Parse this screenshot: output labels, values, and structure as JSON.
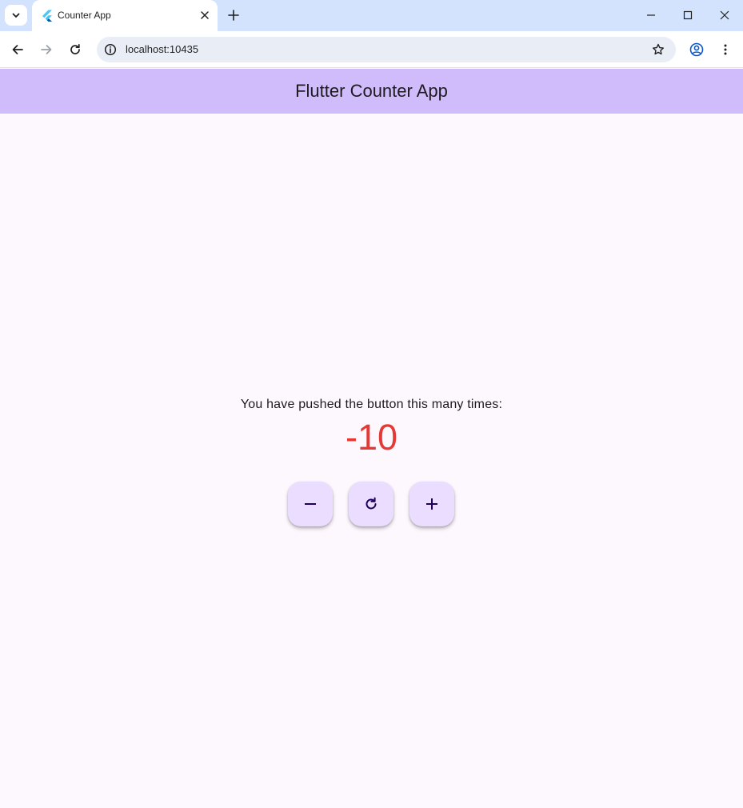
{
  "browser": {
    "tab": {
      "title": "Counter App",
      "favicon": "flutter-logo-icon"
    },
    "address_bar": {
      "url": "localhost:10435"
    },
    "icons": {
      "tab_search": "chevron-down-icon",
      "tab_close": "close-icon",
      "new_tab": "plus-icon",
      "minimize": "minimize-icon",
      "maximize": "maximize-icon",
      "window_close": "close-icon",
      "back": "arrow-left-icon",
      "forward": "arrow-right-icon",
      "reload": "reload-icon",
      "site_info": "site-info-icon",
      "bookmark": "star-icon",
      "profile": "profile-icon",
      "menu": "more-vert-icon"
    },
    "colors": {
      "tabstrip": "#d3e3fd",
      "omnibox": "#e9eef6"
    }
  },
  "app": {
    "app_bar": {
      "title": "Flutter Counter App"
    },
    "body": {
      "prompt": "You have pushed the button this many times:",
      "counter": "-10"
    },
    "buttons": {
      "decrement": "remove-icon",
      "reset": "refresh-icon",
      "increment": "add-icon"
    },
    "colors": {
      "app_bar": "#d1bcfb",
      "background": "#fdf7fe",
      "counter_negative": "#e53935",
      "fab": "#eaddff"
    }
  }
}
